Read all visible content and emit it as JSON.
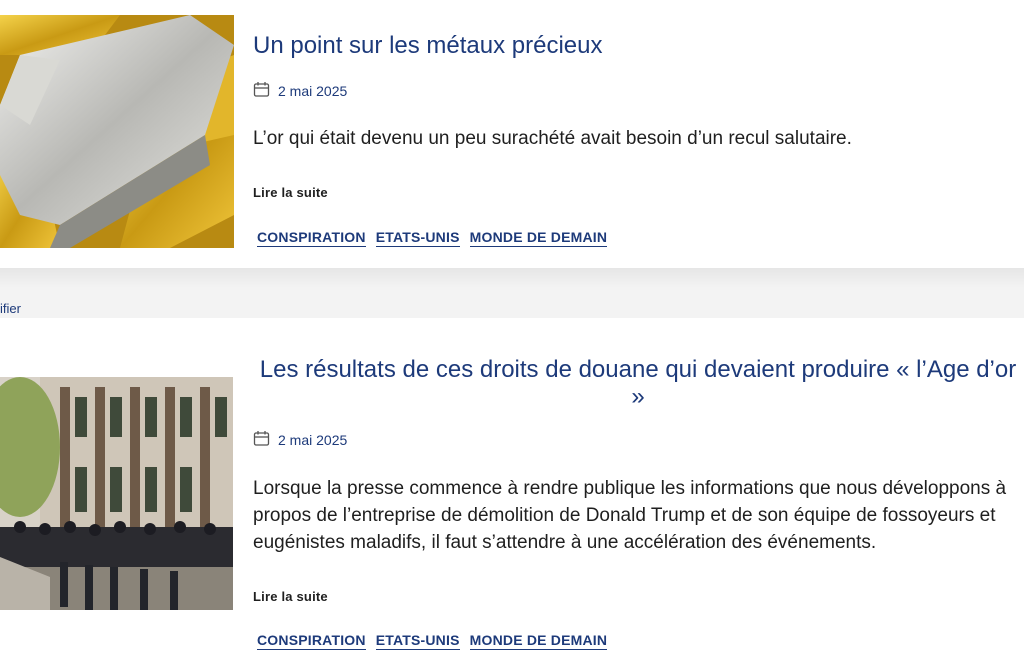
{
  "articles": [
    {
      "title": "Un point sur les métaux précieux",
      "date": "2 mai 2025",
      "excerpt": "L’or qui était devenu un peu surachété avait besoin d’un recul salutaire.",
      "read_more": "Lire la suite",
      "tags": [
        "CONSPIRATION",
        "ETATS-UNIS",
        "MONDE DE DEMAIN"
      ],
      "thumbnail": "gold-silver-bars-photo"
    },
    {
      "title": "Les résultats de ces droits de douane qui devaient produire « l’Age d’or »",
      "date": "2 mai 2025",
      "excerpt": "Lorsque la presse commence à rendre publique les informations que nous développons à propos de l’entreprise de démolition de Donald Trump et de son équipe de fossoyeurs et eugénistes maladifs, il faut s’attendre à une accélération des événements.",
      "read_more": "Lire la suite",
      "tags": [
        "CONSPIRATION",
        "ETATS-UNIS",
        "MONDE DE DEMAIN"
      ],
      "thumbnail": "queue-outside-building-photo"
    }
  ],
  "separator_text": "ifier",
  "icons": {
    "date": "calendar-icon"
  },
  "colors": {
    "link": "#1d3a7a",
    "text": "#1f1f1f",
    "separator": "#efefef"
  }
}
